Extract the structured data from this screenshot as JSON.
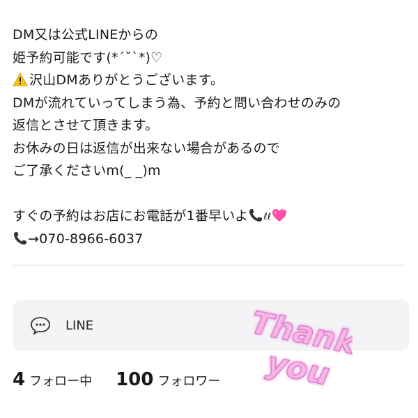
{
  "bio": {
    "line1": "DM又は公式LINEからの",
    "line2": "姫予約可能です(*´˘`*)♡",
    "line3": "沢山DMありがとうございます。",
    "line4": "DMが流れていってしまう為、予約と問い合わせのみの",
    "line5": "返信とさせて頂きます。",
    "line6": "お休みの日は返信が出来ない場合があるので",
    "line7": "ご了承くださいm(_ _)m",
    "line8": "すぐの予約はお店にお電話が1番早いよ",
    "line8_loops": "ℓℓ",
    "line9": "→070-8966-6037"
  },
  "link": {
    "label": "LINE"
  },
  "stats": {
    "following_count": "4",
    "following_label": "フォロー中",
    "followers_count": "100",
    "followers_label": "フォロワー"
  },
  "sticker": {
    "text_top": "Thank",
    "text_bottom": "you"
  },
  "icons": {
    "warning": "warning-icon",
    "phone": "phone-icon",
    "heart": "sparkling-heart-icon",
    "chat": "chat-bubble-icon"
  },
  "colors": {
    "text": "#1a1a1a",
    "card_bg": "#f4f4f6",
    "divider": "#d9d9d9",
    "heart": "#ff4fa3",
    "sticker_pink": "#f6b7e6"
  }
}
